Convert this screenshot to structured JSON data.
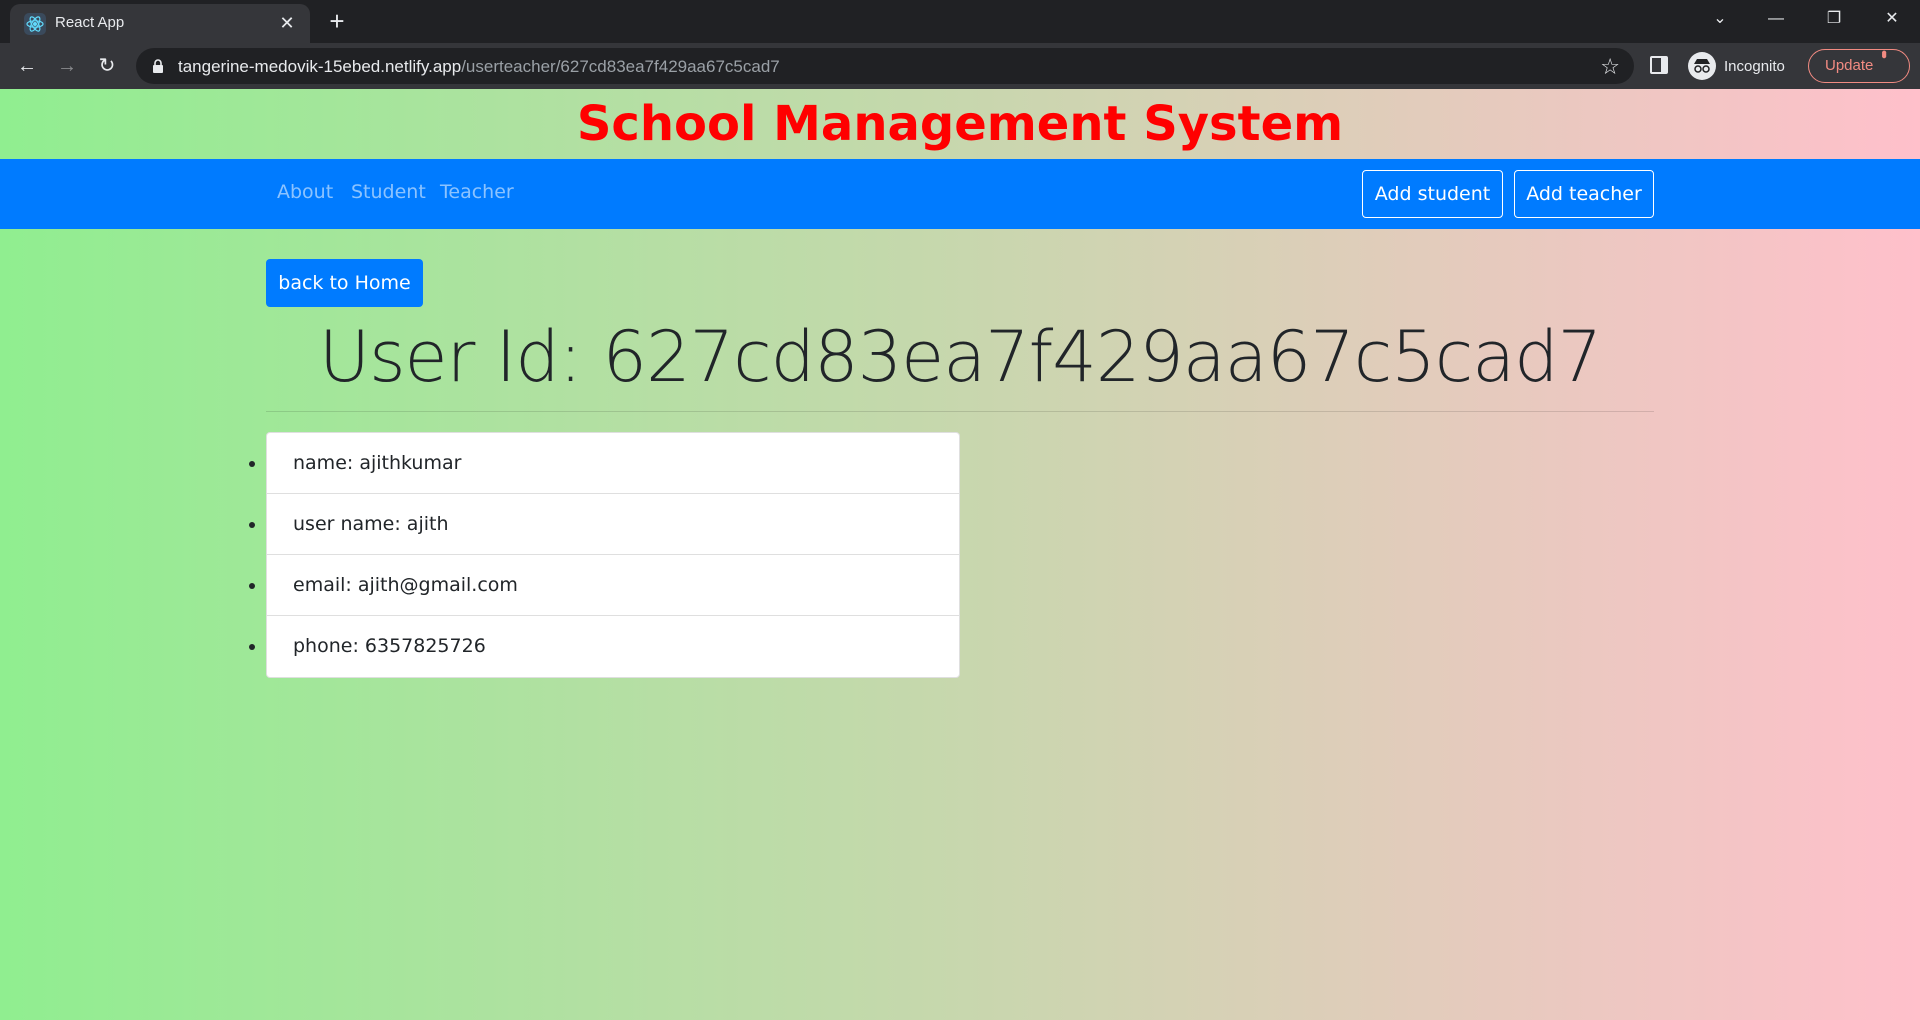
{
  "browser": {
    "tab_title": "React App",
    "url_host": "tangerine-medovik-15ebed.netlify.app",
    "url_path": "/userteacher/627cd83ea7f429aa67c5cad7",
    "profile_label": "Incognito",
    "update_label": "Update"
  },
  "site": {
    "title": "School Management System",
    "nav_links": [
      "About",
      "Student",
      "Teacher"
    ],
    "add_student_label": "Add student",
    "add_teacher_label": "Add teacher"
  },
  "main": {
    "back_label": "back to Home",
    "heading": "User Id: 627cd83ea7f429aa67c5cad7",
    "details": [
      "name: ajithkumar",
      "user name: ajith",
      "email: ajith@gmail.com",
      "phone: 6357825726"
    ]
  },
  "colors": {
    "title": "#ff0000",
    "navbar": "#007bff",
    "gradient_start": "#90ee90",
    "gradient_end": "#ffc0cb"
  }
}
